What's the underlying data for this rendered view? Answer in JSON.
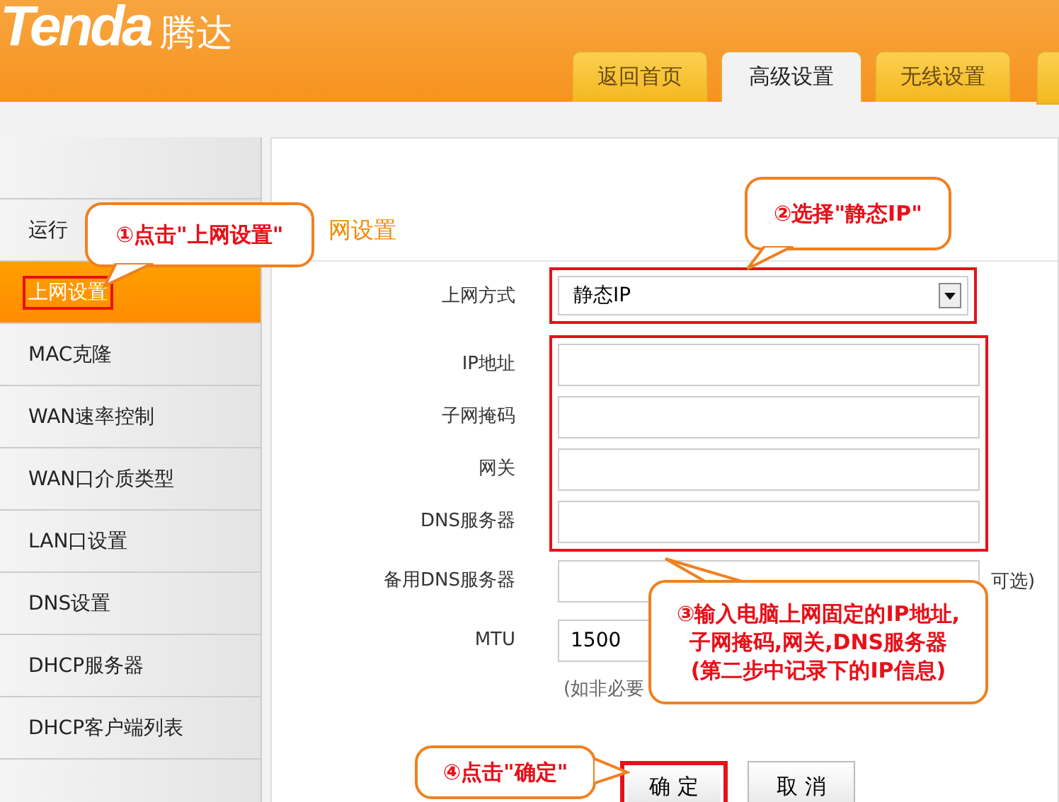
{
  "header": {
    "logo": "Tenda",
    "logo_cn": "腾达"
  },
  "tabs": [
    {
      "label": "返回首页",
      "selected": false
    },
    {
      "label": "高级设置",
      "selected": true
    },
    {
      "label": "无线设置",
      "selected": false
    }
  ],
  "sidebar": {
    "items": [
      {
        "label": "运行",
        "selected": false,
        "highlighted": false
      },
      {
        "label": "上网设置",
        "selected": true,
        "highlighted": true
      },
      {
        "label": "MAC克隆",
        "selected": false,
        "highlighted": false
      },
      {
        "label": "WAN速率控制",
        "selected": false,
        "highlighted": false
      },
      {
        "label": "WAN口介质类型",
        "selected": false,
        "highlighted": false
      },
      {
        "label": "LAN口设置",
        "selected": false,
        "highlighted": false
      },
      {
        "label": "DNS设置",
        "selected": false,
        "highlighted": false
      },
      {
        "label": "DHCP服务器",
        "selected": false,
        "highlighted": false
      },
      {
        "label": "DHCP客户端列表",
        "selected": false,
        "highlighted": false
      }
    ]
  },
  "panel": {
    "title": "网设置",
    "connection": {
      "label": "上网方式",
      "value": "静态IP",
      "highlighted": true
    },
    "fields": [
      {
        "label": "IP地址",
        "highlighted": true
      },
      {
        "label": "子网掩码",
        "highlighted": true
      },
      {
        "label": "网关",
        "highlighted": true
      },
      {
        "label": "DNS服务器",
        "highlighted": true
      },
      {
        "label": "备用DNS服务器",
        "highlighted": false,
        "suffix": "可选)"
      },
      {
        "label": "MTU",
        "highlighted": false,
        "value": "1500",
        "note": "(如非必要"
      }
    ],
    "buttons": [
      {
        "label": "确 定",
        "highlighted": true
      },
      {
        "label": "取 消",
        "highlighted": false
      }
    ]
  },
  "callouts": [
    {
      "text": "①点击\"上网设置\""
    },
    {
      "text": "②选择\"静态IP\""
    },
    {
      "text": "③输入电脑上网固定的IP地址,\n子网掩码,网关,DNS服务器\n(第二步中记录下的IP信息)"
    },
    {
      "text": "④点击\"确定\""
    }
  ]
}
